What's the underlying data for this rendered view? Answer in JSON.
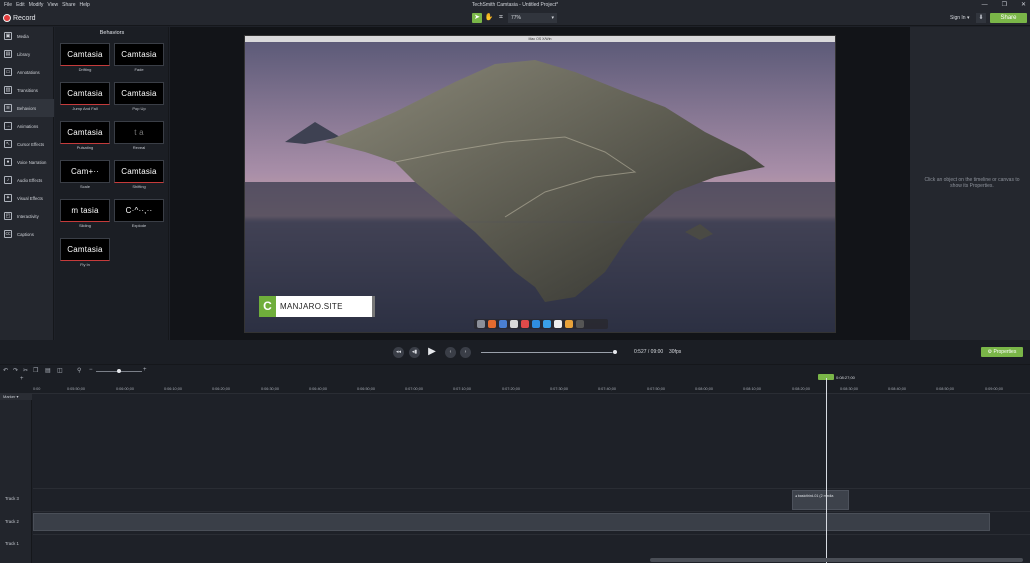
{
  "menu": [
    "File",
    "Edit",
    "Modify",
    "View",
    "Share",
    "Help"
  ],
  "app_title": "TechSmith Camtasia - Untitled Project*",
  "record_label": "Record",
  "zoom_level": "77%",
  "sign_in": "Sign In ▾",
  "share_label": "Share",
  "sidebar": [
    {
      "label": "Media",
      "icon": "media-icon"
    },
    {
      "label": "Library",
      "icon": "library-icon"
    },
    {
      "label": "Annotations",
      "icon": "annotations-icon"
    },
    {
      "label": "Transitions",
      "icon": "transitions-icon"
    },
    {
      "label": "Behaviors",
      "icon": "behaviors-icon"
    },
    {
      "label": "Animations",
      "icon": "animations-icon"
    },
    {
      "label": "Cursor Effects",
      "icon": "cursor-icon"
    },
    {
      "label": "Voice Narration",
      "icon": "microphone-icon"
    },
    {
      "label": "Audio Effects",
      "icon": "audio-icon"
    },
    {
      "label": "Visual Effects",
      "icon": "visual-effects-icon"
    },
    {
      "label": "Interactivity",
      "icon": "interactivity-icon"
    },
    {
      "label": "Captions",
      "icon": "captions-icon"
    }
  ],
  "panel_title": "Behaviors",
  "behaviors": [
    {
      "name": "Drifting",
      "thumb": "Camtasia"
    },
    {
      "name": "Fade",
      "thumb": "Camtasia"
    },
    {
      "name": "Jump And Fall",
      "thumb": "Camtasia"
    },
    {
      "name": "Pop Up",
      "thumb": "Camtasia"
    },
    {
      "name": "Pulsating",
      "thumb": "Camtasia"
    },
    {
      "name": "Reveal",
      "thumb": "t a"
    },
    {
      "name": "Scale",
      "thumb": "Cam+··"
    },
    {
      "name": "Shifting",
      "thumb": "Camtasia"
    },
    {
      "name": "Sliding",
      "thumb": "m tasia"
    },
    {
      "name": "Explode",
      "thumb": "C·^··,··"
    },
    {
      "name": "Fly In",
      "thumb": "Camtasia"
    }
  ],
  "mac_title": "Mac OS X/Win",
  "watermark": "MANJARO.SITE",
  "properties_hint": "Click an object on the timeline or canvas to show its Properties.",
  "timecode": "0:527 / 09:00",
  "fps": "30fps",
  "properties_button": "Properties",
  "playhead_time": "0:08:27;00",
  "ruler_ticks": [
    "0:00",
    "0:05:50;00",
    "0:06:00;00",
    "0:06:10;00",
    "0:06:20;00",
    "0:06:30;00",
    "0:06:40;00",
    "0:06:50;00",
    "0:07:00;00",
    "0:07:10;00",
    "0:07:20;00",
    "0:07:30;00",
    "0:07:40;00",
    "0:07:50;00",
    "0:08:00;00",
    "0:08:10;00",
    "0:08:20;00",
    "0:08:30;00",
    "0:08:40;00",
    "0:08:50;00",
    "0:09:00;00"
  ],
  "marker_label": "Marker ▾",
  "tracks": [
    "Track 3",
    "Track 2",
    "Track 1"
  ],
  "clip3_label": "◂ basicthird-01   (2 media"
}
